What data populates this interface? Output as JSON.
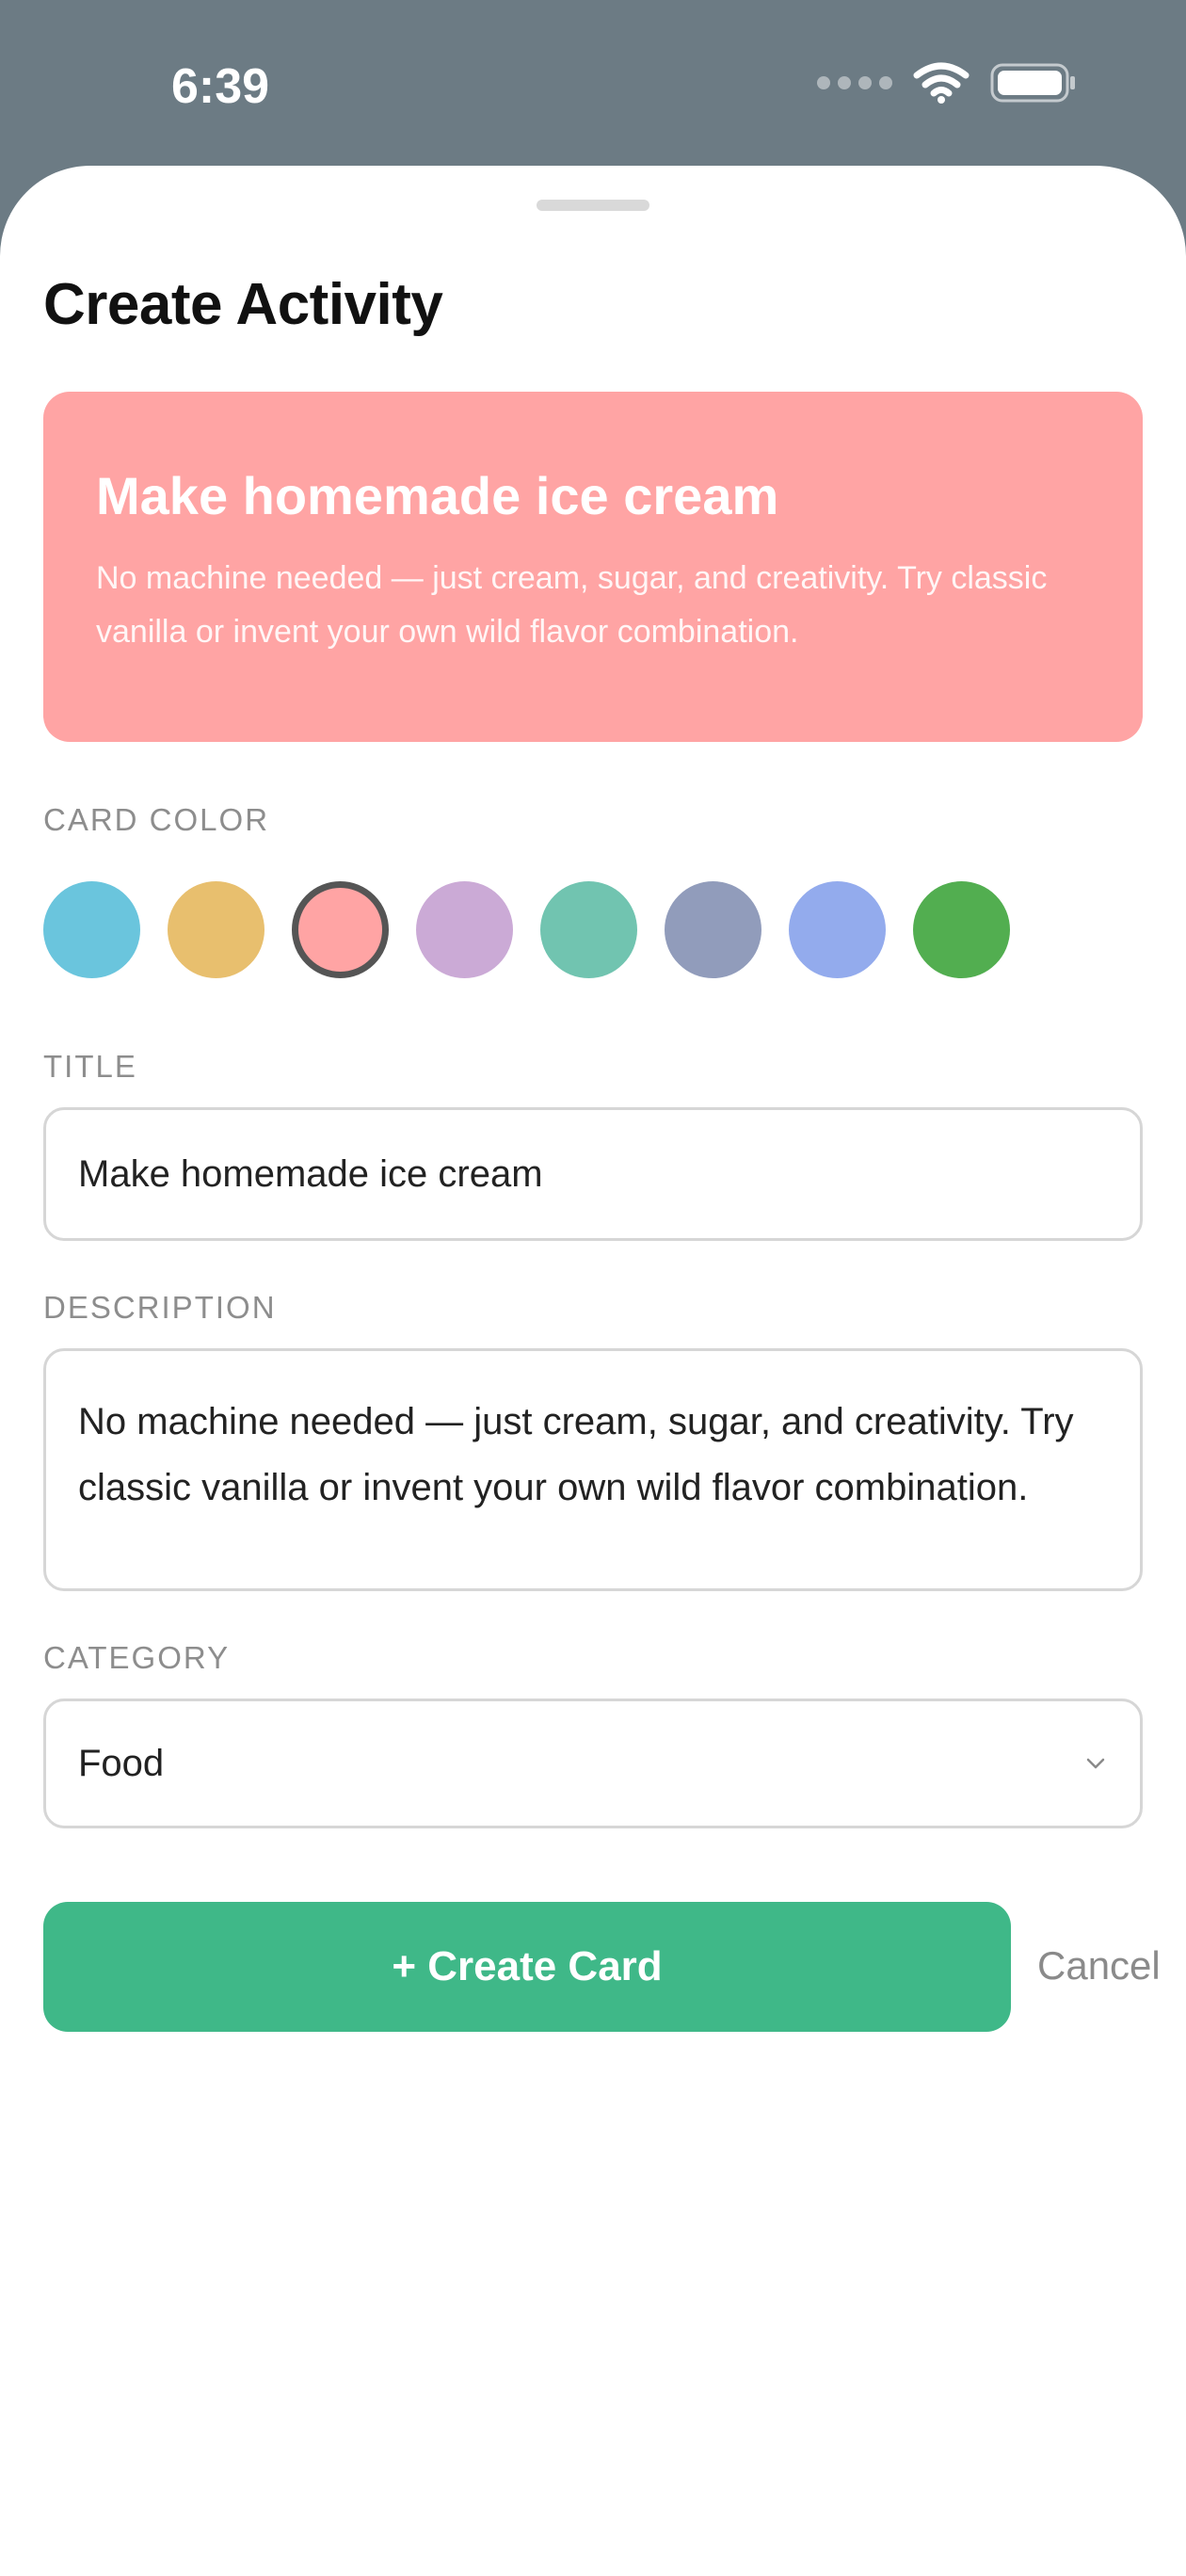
{
  "status_bar": {
    "time": "6:39"
  },
  "sheet": {
    "title": "Create Activity"
  },
  "preview": {
    "title": "Make homemade ice cream",
    "description": "No machine needed — just cream, sugar, and creativity. Try classic vanilla or invent your own wild flavor combination.",
    "color": "#ffa4a4"
  },
  "card_color": {
    "label": "CARD COLOR",
    "options": [
      "#6ac5dd",
      "#e8bf6e",
      "#ffa4a4",
      "#cbaad6",
      "#71c4b0",
      "#919cbb",
      "#93abed",
      "#52ae50"
    ],
    "selected_index": 2
  },
  "title_field": {
    "label": "TITLE",
    "value": "Make homemade ice cream"
  },
  "description_field": {
    "label": "DESCRIPTION",
    "value": "No machine needed — just cream, sugar, and creativity. Try classic vanilla or invent your own wild flavor combination."
  },
  "category_field": {
    "label": "CATEGORY",
    "value": "Food"
  },
  "actions": {
    "create_label": "+ Create Card",
    "cancel_label": "Cancel"
  },
  "colors": {
    "accent": "#3fb888",
    "backdrop": "#6c7b84"
  }
}
